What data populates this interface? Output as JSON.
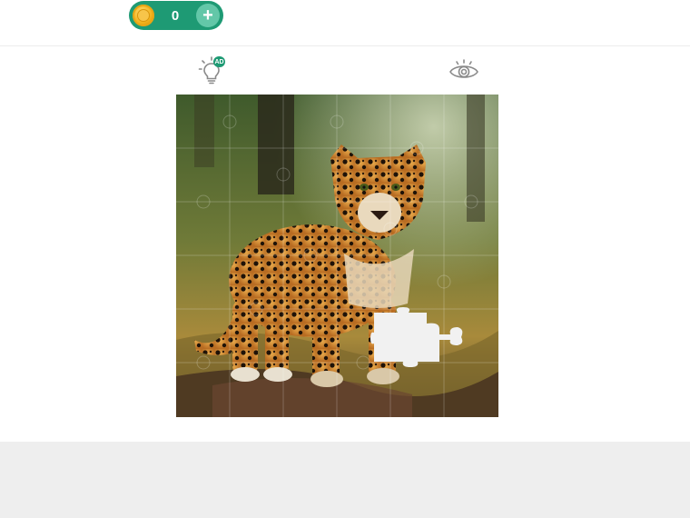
{
  "header": {
    "coins": "0",
    "add_label": "+"
  },
  "toolbar": {
    "hint_badge": "AD",
    "hint_icon": "lightbulb-icon",
    "preview_icon": "eye-icon"
  },
  "puzzle": {
    "subject": "leopard",
    "grid_rows": 6,
    "grid_cols": 6,
    "missing_pieces": 1
  },
  "colors": {
    "accent": "#1e9a74",
    "accent_light": "#63c7a8",
    "footer": "#eeeeee"
  }
}
